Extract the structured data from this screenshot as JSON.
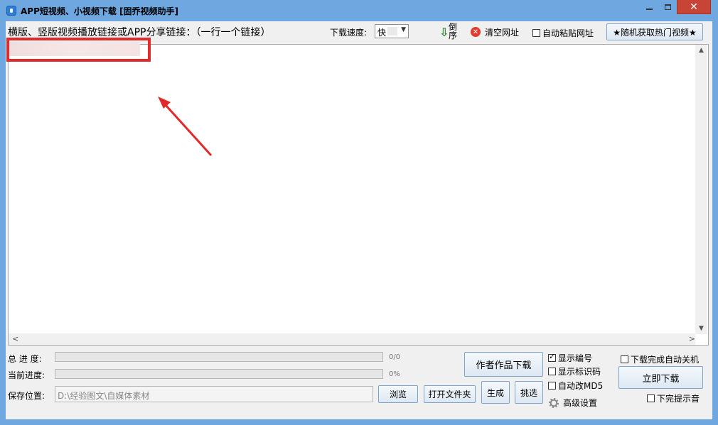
{
  "window": {
    "title": "APP短视频、小视频下载 [固乔视频助手]"
  },
  "toolbar": {
    "prompt_label": "横版、竖版视频播放链接或APP分享链接：（一行一个链接）",
    "speed_label": "下载速度:",
    "speed_value": "快",
    "reverse_label": "倒序",
    "clear_label": "清空网址",
    "auto_paste_label": "自动粘贴网址",
    "auto_paste_checked": false,
    "hot_videos_label": "★随机获取热门视频★"
  },
  "links_textarea": {
    "value": ""
  },
  "progress": {
    "total_label": "总 进 度:",
    "total_value": 0,
    "total_text": "0/0",
    "current_label": "当前进度:",
    "current_value": 0,
    "current_text": "0%"
  },
  "save": {
    "label": "保存位置:",
    "path": "D:\\经验图文\\自媒体素材",
    "browse_label": "浏览",
    "open_folder_label": "打开文件夹"
  },
  "actions": {
    "author_download_label": "作者作品下载",
    "generate_label": "生成",
    "pick_label": "挑选",
    "download_now_label": "立即下载"
  },
  "options": {
    "show_number_label": "显示编号",
    "show_number_checked": true,
    "show_watermark_label": "显示标识码",
    "show_watermark_checked": false,
    "auto_md5_label": "自动改MD5",
    "auto_md5_checked": false,
    "advanced_label": "高级设置",
    "auto_shutdown_label": "下载完成自动关机",
    "auto_shutdown_checked": false,
    "done_sound_label": "下完提示音",
    "done_sound_checked": false
  },
  "colors": {
    "window_frame": "#6fa7e0",
    "close_button": "#c74536",
    "highlight_box": "#e32a2a",
    "annotation_arrow": "#e32a2a"
  }
}
